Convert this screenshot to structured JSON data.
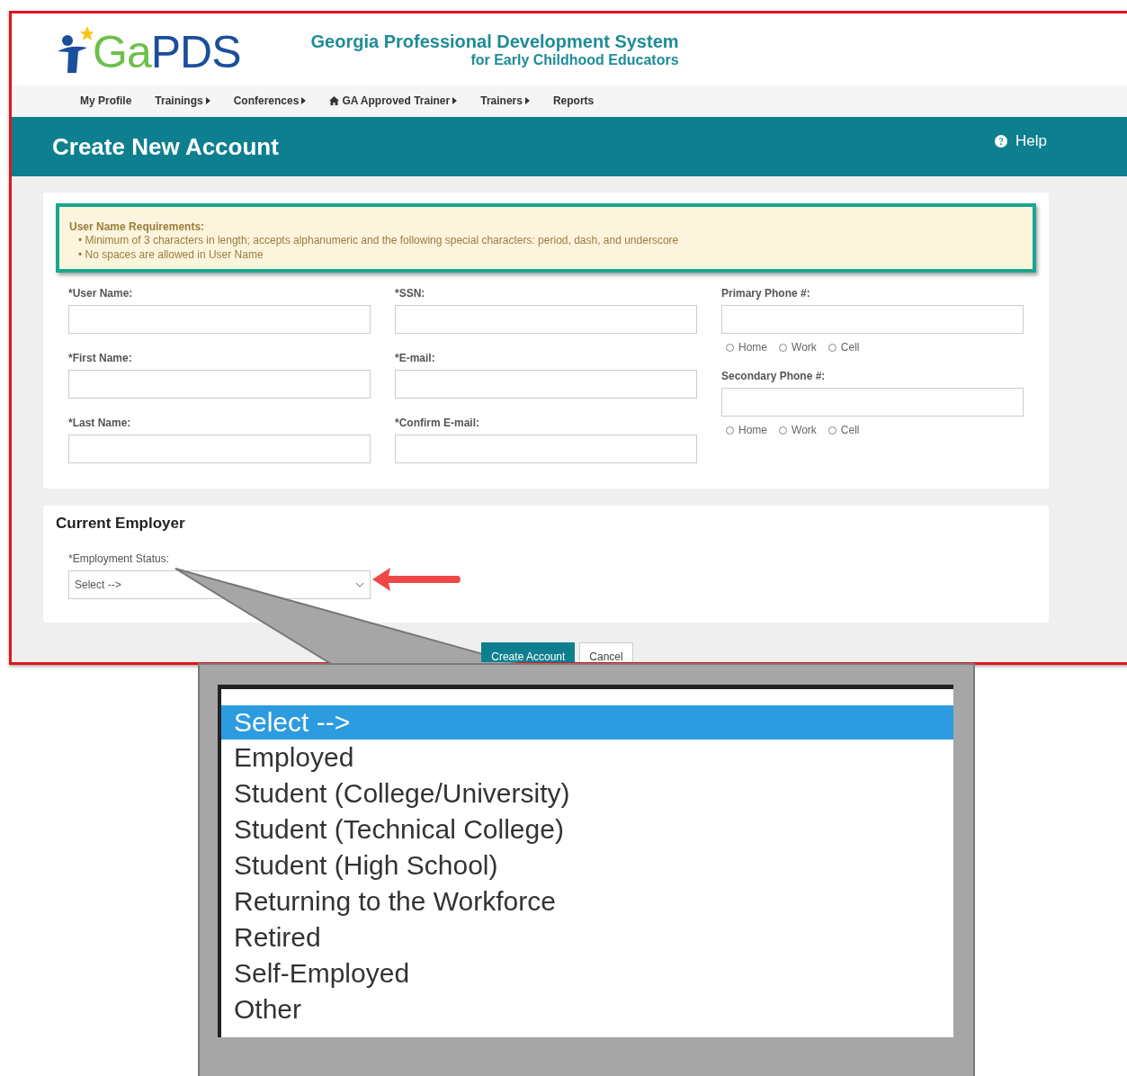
{
  "header": {
    "logo_part_1": "Ga",
    "logo_part_2": "PDS",
    "title": "Georgia Professional Development System",
    "subtitle": "for Early Childhood Educators"
  },
  "nav": [
    {
      "label": "My Profile",
      "has_icon": false,
      "has_submenu": false
    },
    {
      "label": "Trainings",
      "has_icon": false,
      "has_submenu": true
    },
    {
      "label": "Conferences",
      "has_icon": false,
      "has_submenu": true
    },
    {
      "label": "GA Approved Trainer",
      "has_icon": true,
      "has_submenu": true
    },
    {
      "label": "Trainers",
      "has_icon": false,
      "has_submenu": true
    },
    {
      "label": "Reports",
      "has_icon": false,
      "has_submenu": false
    }
  ],
  "page_title": "Create New Account",
  "help": "Help",
  "requirements": {
    "title": "User Name Requirements:",
    "items": [
      "• Minimum of 3 characters in length; accepts alphanumeric and the following special characters: period, dash, and underscore",
      "• No spaces are allowed in User Name"
    ]
  },
  "form_columns": [
    [
      {
        "label": "*User Name:"
      },
      {
        "label": "*First Name:"
      },
      {
        "label": "*Last Name:"
      }
    ],
    [
      {
        "label": "*SSN:"
      },
      {
        "label": "*E-mail:"
      },
      {
        "label": "*Confirm E-mail:"
      }
    ],
    [
      {
        "label": "Primary Phone #:",
        "options": [
          {
            "label": "Home",
            "selected": false
          },
          {
            "label": "Work",
            "selected": false
          },
          {
            "label": "Cell",
            "selected": false
          }
        ]
      },
      {
        "label": "Secondary Phone #:",
        "options": [
          {
            "label": "Home",
            "selected": false
          },
          {
            "label": "Work",
            "selected": false
          },
          {
            "label": "Cell",
            "selected": false
          }
        ]
      }
    ]
  ],
  "employer": {
    "title": "Current Employer",
    "field_label": "*Employment Status:",
    "value": "Select -->"
  },
  "buttons": [
    {
      "label": "Create Account",
      "kind": "primary"
    },
    {
      "label": "Cancel",
      "kind": "secondary"
    }
  ],
  "callout": {
    "options": [
      {
        "label": "Select -->",
        "selected": true
      },
      {
        "label": "Employed",
        "selected": false
      },
      {
        "label": "Student (College/University)",
        "selected": false
      },
      {
        "label": "Student (Technical College)",
        "selected": false
      },
      {
        "label": "Student (High School)",
        "selected": false
      },
      {
        "label": "Returning to the Workforce",
        "selected": false
      },
      {
        "label": "Retired",
        "selected": false
      },
      {
        "label": "Self-Employed",
        "selected": false
      },
      {
        "label": "Other",
        "selected": false
      }
    ]
  }
}
